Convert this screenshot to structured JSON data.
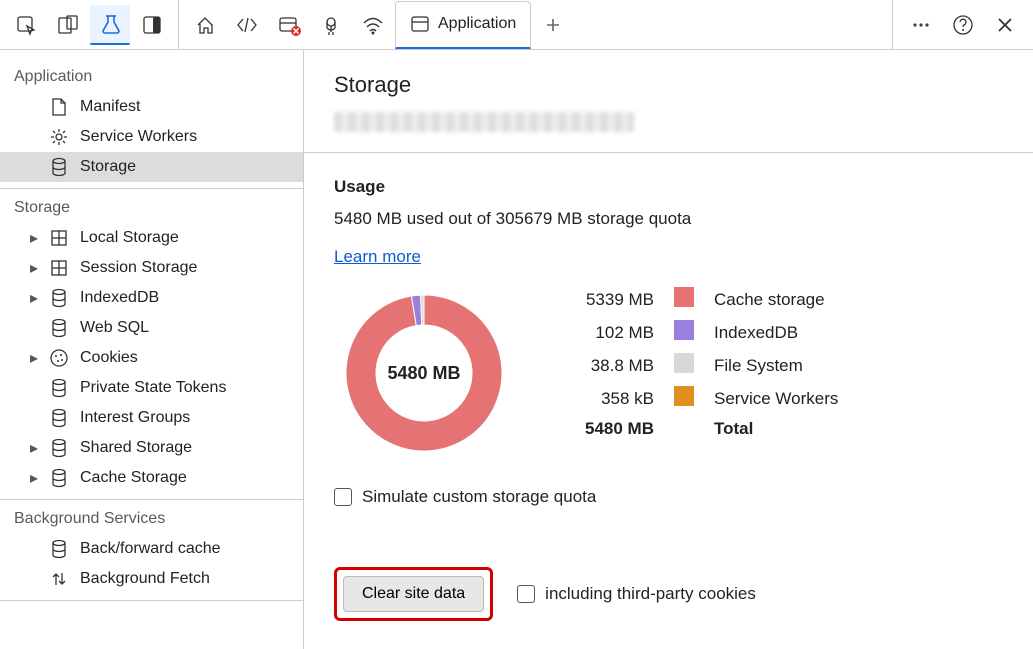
{
  "toolbar": {
    "activeTab": "Application",
    "appTabLabel": "Application"
  },
  "sidebar": {
    "sections": [
      {
        "title": "Application",
        "items": [
          {
            "label": "Manifest",
            "icon": "file-icon"
          },
          {
            "label": "Service Workers",
            "icon": "gear-icon"
          },
          {
            "label": "Storage",
            "icon": "db-icon",
            "selected": true
          }
        ]
      },
      {
        "title": "Storage",
        "items": [
          {
            "label": "Local Storage",
            "icon": "grid-icon",
            "caret": true
          },
          {
            "label": "Session Storage",
            "icon": "grid-icon",
            "caret": true
          },
          {
            "label": "IndexedDB",
            "icon": "db-icon",
            "caret": true
          },
          {
            "label": "Web SQL",
            "icon": "db-icon"
          },
          {
            "label": "Cookies",
            "icon": "cookie-icon",
            "caret": true
          },
          {
            "label": "Private State Tokens",
            "icon": "db-icon"
          },
          {
            "label": "Interest Groups",
            "icon": "db-icon"
          },
          {
            "label": "Shared Storage",
            "icon": "db-icon",
            "caret": true
          },
          {
            "label": "Cache Storage",
            "icon": "db-icon",
            "caret": true
          }
        ]
      },
      {
        "title": "Background Services",
        "items": [
          {
            "label": "Back/forward cache",
            "icon": "db-icon"
          },
          {
            "label": "Background Fetch",
            "icon": "updown-icon"
          }
        ]
      }
    ]
  },
  "main": {
    "pageTitle": "Storage",
    "usage": {
      "heading": "Usage",
      "text": "5480 MB used out of 305679 MB storage quota",
      "learnMore": "Learn more",
      "donutCenter": "5480 MB",
      "legend": [
        {
          "value": "5339 MB",
          "color": "#e57373",
          "name": "Cache storage"
        },
        {
          "value": "102 MB",
          "color": "#9b7ede",
          "name": "IndexedDB"
        },
        {
          "value": "38.8 MB",
          "color": "#d7d7d7",
          "name": "File System"
        },
        {
          "value": "358 kB",
          "color": "#e08f1e",
          "name": "Service Workers"
        }
      ],
      "total": {
        "value": "5480 MB",
        "name": "Total"
      },
      "simulateLabel": "Simulate custom storage quota"
    },
    "actions": {
      "clearButton": "Clear site data",
      "thirdPartyLabel": "including third-party cookies"
    }
  },
  "chart_data": {
    "type": "pie",
    "title": "Storage usage breakdown",
    "unit": "MB",
    "series": [
      {
        "name": "Cache storage",
        "value": 5339,
        "color": "#e57373"
      },
      {
        "name": "IndexedDB",
        "value": 102,
        "color": "#9b7ede"
      },
      {
        "name": "File System",
        "value": 38.8,
        "color": "#d7d7d7"
      },
      {
        "name": "Service Workers",
        "value": 0.358,
        "color": "#e08f1e"
      }
    ],
    "total": 5480,
    "quota": 305679
  }
}
